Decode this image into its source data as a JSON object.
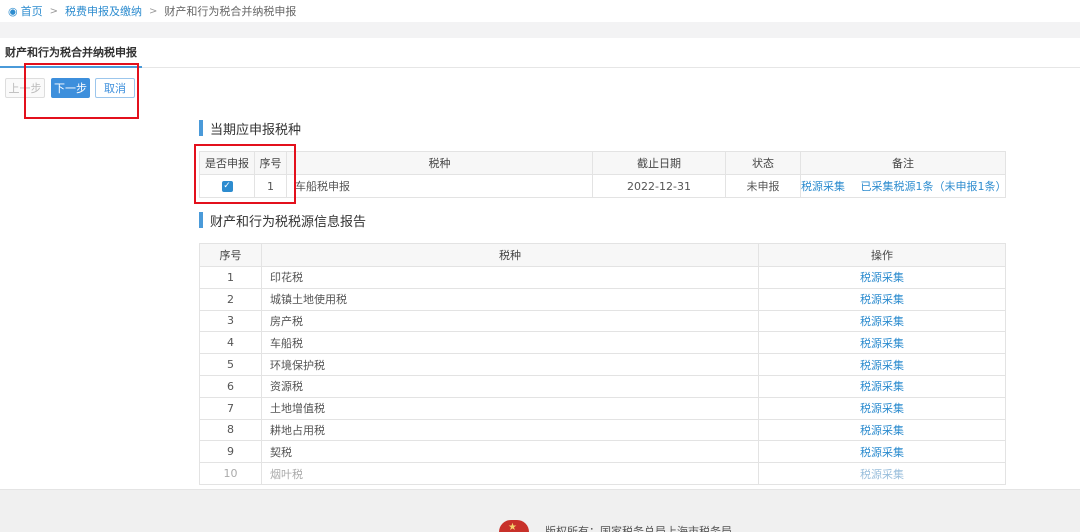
{
  "breadcrumb": {
    "home": "首页",
    "level1": "税费申报及缴纳",
    "current": "财产和行为税合并纳税申报",
    "separator": ">"
  },
  "tab": {
    "label": "财产和行为税合并纳税申报"
  },
  "actions": {
    "prev": "上一步",
    "next": "下一步",
    "cancel": "取消"
  },
  "section1": {
    "title": "当期应申报税种",
    "headers": {
      "declare": "是否申报",
      "seq": "序号",
      "tax": "税种",
      "deadline": "截止日期",
      "status": "状态",
      "remark": "备注"
    },
    "row": {
      "checked": true,
      "seq": "1",
      "tax": "车船税申报",
      "deadline": "2022-12-31",
      "status": "未申报",
      "remark_link": "税源采集",
      "remark_text": "已采集税源1条（未申报1条）"
    }
  },
  "section2": {
    "title": "财产和行为税税源信息报告",
    "headers": {
      "seq": "序号",
      "tax": "税种",
      "op": "操作"
    },
    "rows": [
      {
        "seq": "1",
        "tax": "印花税",
        "op": "税源采集"
      },
      {
        "seq": "2",
        "tax": "城镇土地使用税",
        "op": "税源采集"
      },
      {
        "seq": "3",
        "tax": "房产税",
        "op": "税源采集"
      },
      {
        "seq": "4",
        "tax": "车船税",
        "op": "税源采集"
      },
      {
        "seq": "5",
        "tax": "环境保护税",
        "op": "税源采集"
      },
      {
        "seq": "6",
        "tax": "资源税",
        "op": "税源采集"
      },
      {
        "seq": "7",
        "tax": "土地增值税",
        "op": "税源采集"
      },
      {
        "seq": "8",
        "tax": "耕地占用税",
        "op": "税源采集"
      },
      {
        "seq": "9",
        "tax": "契税",
        "op": "税源采集"
      },
      {
        "seq": "10",
        "tax": "烟叶税",
        "op": "税源采集"
      }
    ]
  },
  "footer": {
    "copyright": "版权所有：国家税务总局上海市税务局"
  },
  "colors": {
    "accent": "#2d8ccf",
    "primary_button": "#3d8fdc",
    "highlight": "#e3101c",
    "footer_bg": "#f0f0f0"
  },
  "icons": {
    "home": "location-pin-icon",
    "check": "checkbox-checked-icon",
    "emblem": "tax-emblem-icon"
  }
}
